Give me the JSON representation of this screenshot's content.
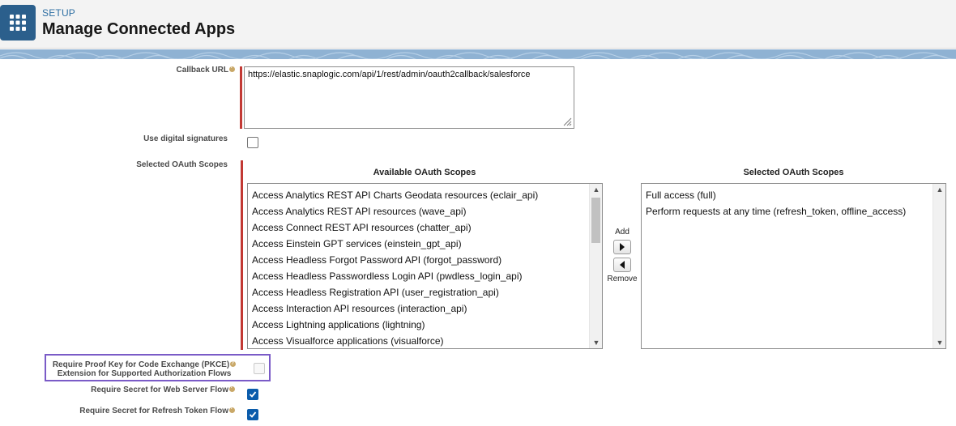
{
  "header": {
    "section": "SETUP",
    "title": "Manage Connected Apps",
    "app_icon": "app-launcher-grid-icon"
  },
  "form": {
    "callback_url": {
      "label": "Callback URL",
      "value": "https://elastic.snaplogic.com/api/1/rest/admin/oauth2callback/salesforce"
    },
    "digital_signatures": {
      "label": "Use digital signatures",
      "checked": false
    },
    "oauth_scopes": {
      "label": "Selected OAuth Scopes",
      "available_header": "Available OAuth Scopes",
      "selected_header": "Selected OAuth Scopes",
      "available": [
        "Access Analytics REST API Charts Geodata resources (eclair_api)",
        "Access Analytics REST API resources (wave_api)",
        "Access Connect REST API resources (chatter_api)",
        "Access Einstein GPT services (einstein_gpt_api)",
        "Access Headless Forgot Password API (forgot_password)",
        "Access Headless Passwordless Login API (pwdless_login_api)",
        "Access Headless Registration API (user_registration_api)",
        "Access Interaction API resources (interaction_api)",
        "Access Lightning applications (lightning)",
        "Access Visualforce applications (visualforce)"
      ],
      "selected": [
        "Full access (full)",
        "Perform requests at any time (refresh_token, offline_access)"
      ],
      "add_label": "Add",
      "remove_label": "Remove"
    },
    "pkce": {
      "label_line1": "Require Proof Key for Code Exchange (PKCE)",
      "label_line2": "Extension for Supported Authorization Flows",
      "checked": false
    },
    "secret_web_server": {
      "label": "Require Secret for Web Server Flow",
      "checked": true
    },
    "secret_refresh": {
      "label": "Require Secret for Refresh Token Flow",
      "checked": true
    }
  },
  "colors": {
    "required": "#c23934",
    "checked": "#0b5cab",
    "highlight": "#7a5bc7",
    "icon_bg": "#2b5f8c"
  }
}
